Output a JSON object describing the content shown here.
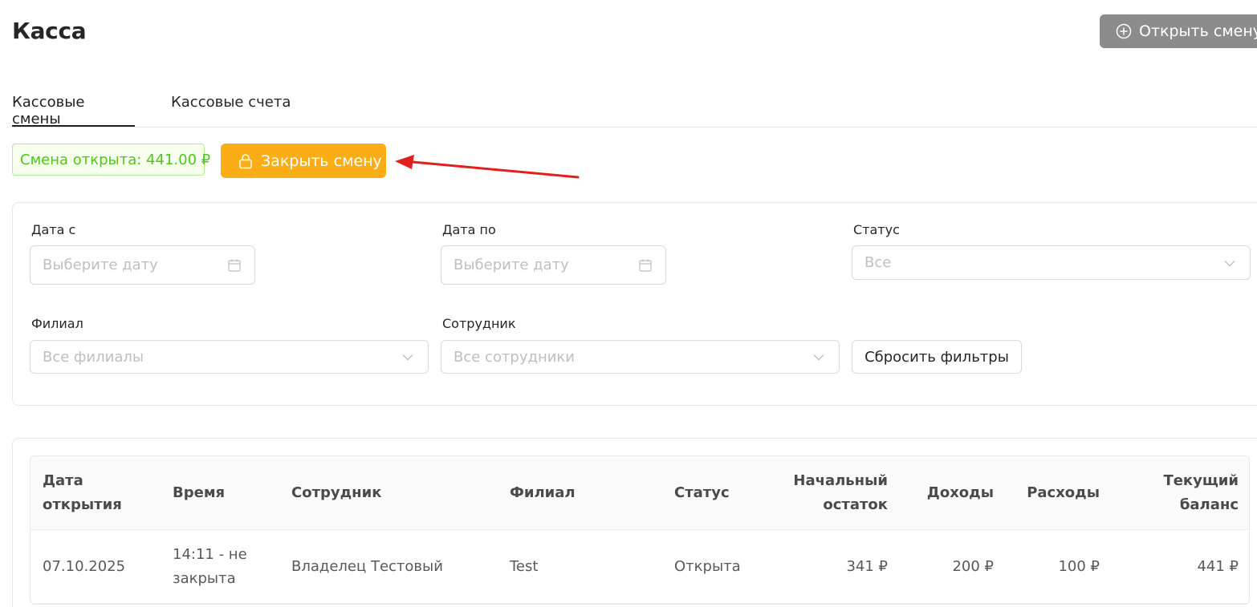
{
  "header": {
    "title": "Касса",
    "open_shift_label": "Открыть смену"
  },
  "tabs": [
    {
      "label": "Кассовые смены",
      "active": true
    },
    {
      "label": "Кассовые счета",
      "active": false
    }
  ],
  "shift": {
    "status_text": "Смена открыта: 441.00 ₽",
    "close_label": "Закрыть смену"
  },
  "filters": {
    "date_from": {
      "label": "Дата с",
      "placeholder": "Выберите дату"
    },
    "date_to": {
      "label": "Дата по",
      "placeholder": "Выберите дату"
    },
    "status": {
      "label": "Статус",
      "value": "Все"
    },
    "branch": {
      "label": "Филиал",
      "placeholder": "Все филиалы"
    },
    "employee": {
      "label": "Сотрудник",
      "placeholder": "Все сотрудники"
    },
    "reset_label": "Сбросить фильтры"
  },
  "table": {
    "columns": [
      "Дата открытия",
      "Время",
      "Сотрудник",
      "Филиал",
      "Статус",
      "Начальный остаток",
      "Доходы",
      "Расходы",
      "Текущий баланс"
    ],
    "rows": [
      [
        "07.10.2025",
        "14:11 - не закрыта",
        "Владелец Тестовый",
        "Test",
        "Открыта",
        "341 ₽",
        "200 ₽",
        "100 ₽",
        "441 ₽"
      ]
    ]
  },
  "colors": {
    "accent_orange": "#faad14",
    "success_green": "#52c41a",
    "success_bg": "#f6ffed",
    "disabled_gray": "#8c8c8c",
    "annotation_red": "#e0211d"
  },
  "icons": {
    "open_shift": "plus-circle-icon",
    "close_shift": "lock-icon",
    "date": "calendar-icon",
    "select": "chevron-down-icon"
  }
}
